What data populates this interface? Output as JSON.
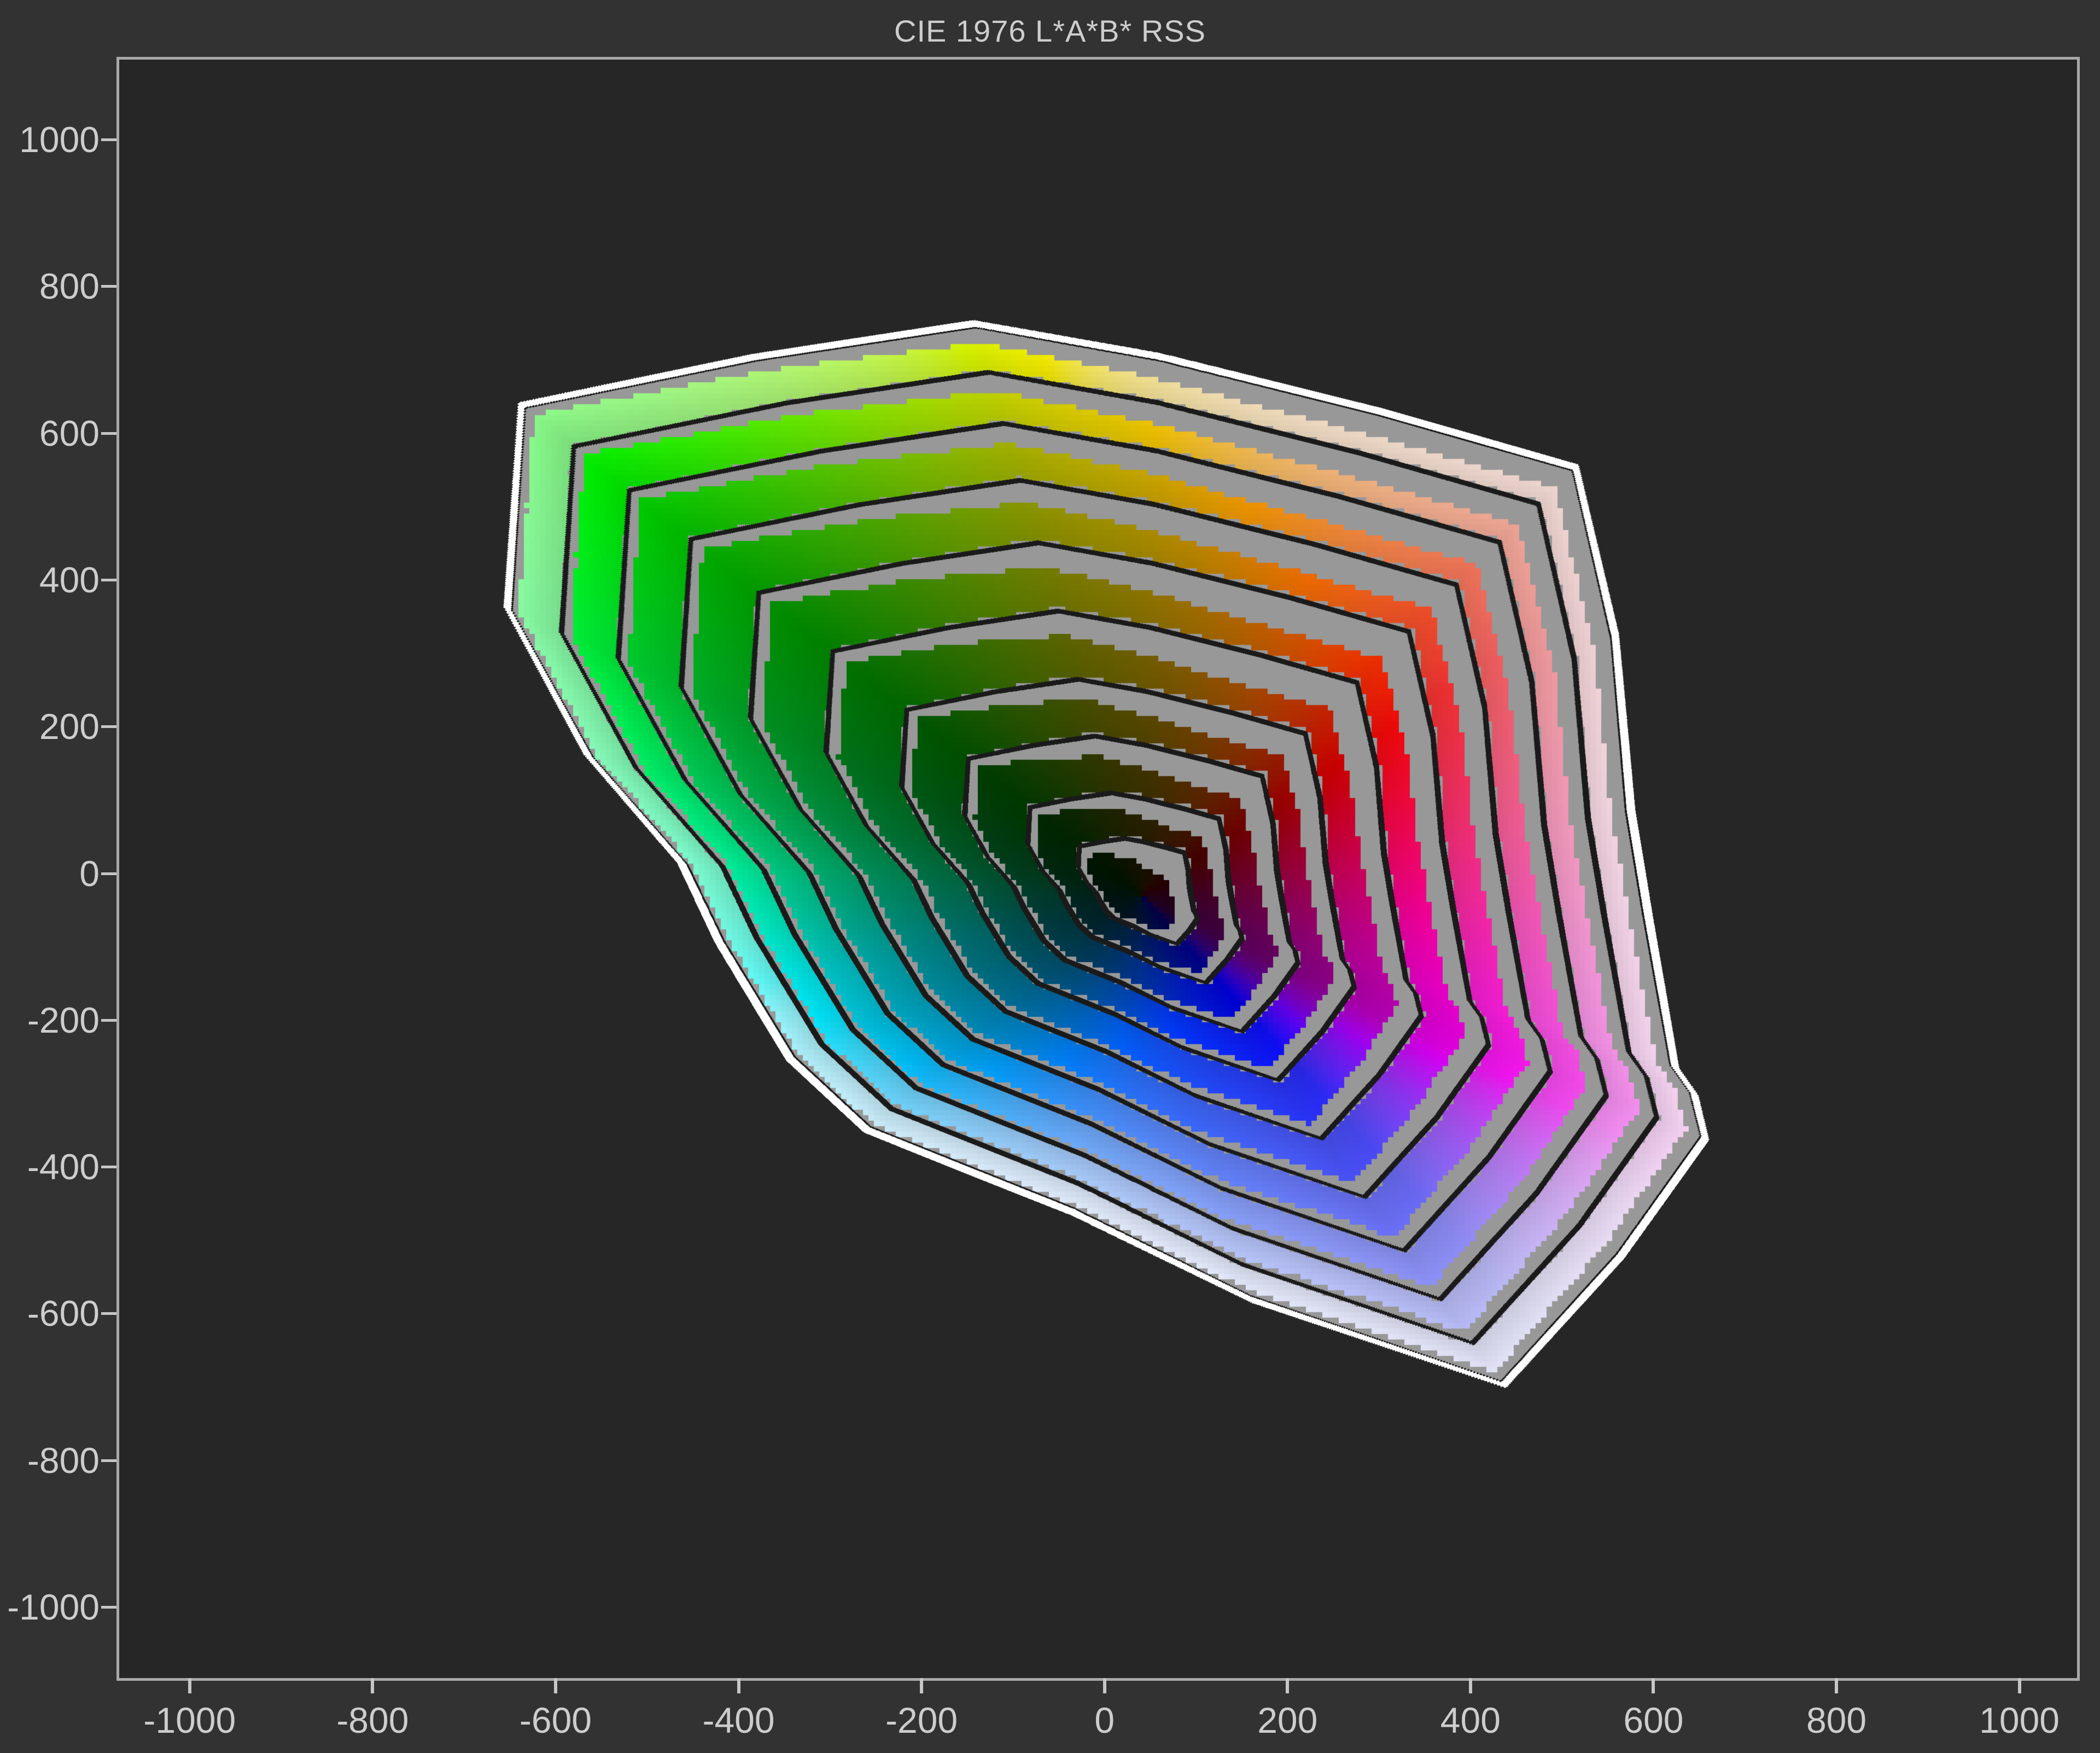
{
  "title": "CIE 1976 L*A*B* RSS",
  "colors": {
    "page_bg": "#323232",
    "plot_bg": "#262626",
    "axis_border": "#a8a8a8",
    "tick": "#c6c6c6",
    "tick_label": "#cdcdcd",
    "title": "#cdcdcd",
    "ring_gray": "#989898",
    "ring_outline": "#1a1a1a",
    "hull_outline": "#ffffff"
  },
  "axes": {
    "x": {
      "ticks": [
        -1000,
        -800,
        -600,
        -400,
        -200,
        0,
        200,
        400,
        600,
        800,
        1000
      ],
      "lim": [
        -1077,
        1063
      ]
    },
    "y": {
      "ticks": [
        1000,
        800,
        600,
        400,
        200,
        0,
        -200,
        -400,
        -600,
        -800,
        -1000
      ],
      "lim": [
        -1097,
        1109
      ]
    }
  },
  "chart_data": {
    "type": "area",
    "variant": "gamut-rings (CIELAB a*-b* RSS projection, nested lightness slices)",
    "title": "CIE 1976 L*A*B* RSS",
    "xlabel": "",
    "ylabel": "",
    "grid": false,
    "legend": false,
    "xlim": [
      -1077,
      1063
    ],
    "ylim": [
      -1097,
      1109
    ],
    "x_tick_labels": [
      "-1000",
      "-800",
      "-600",
      "-400",
      "-200",
      "0",
      "200",
      "400",
      "600",
      "800",
      "1000"
    ],
    "y_tick_labels": [
      "1000",
      "800",
      "600",
      "400",
      "200",
      "0",
      "-200",
      "-400",
      "-600",
      "-800",
      "-1000"
    ],
    "rings": {
      "count": 10,
      "L_star_slices": [
        10,
        20,
        30,
        40,
        50,
        60,
        70,
        80,
        90,
        100
      ],
      "display_L": [
        12,
        20,
        29,
        38,
        47,
        56,
        65,
        74,
        85,
        95
      ],
      "radial_fractions": [
        0.1,
        0.18,
        0.28,
        0.38,
        0.5,
        0.62,
        0.73,
        0.83,
        0.92,
        1.0
      ]
    },
    "center": [
      40,
      -30
    ],
    "outer_boundary": [
      [
        571,
        84
      ],
      [
        555,
        320
      ],
      [
        513,
        549
      ],
      [
        300,
        625
      ],
      [
        60,
        700
      ],
      [
        -140,
        745
      ],
      [
        -380,
        700
      ],
      [
        -633,
        636
      ],
      [
        -648,
        360
      ],
      [
        -560,
        160
      ],
      [
        -457,
        13
      ],
      [
        -417,
        -92
      ],
      [
        -340,
        -250
      ],
      [
        -257,
        -346
      ],
      [
        -35,
        -457
      ],
      [
        159,
        -577
      ],
      [
        433,
        -694
      ],
      [
        560,
        -520
      ],
      [
        652,
        -360
      ],
      [
        640,
        -300
      ],
      [
        619,
        -263
      ],
      [
        590,
        -60
      ]
    ],
    "hue_anchors_lab_to_css": [
      [
        40,
        0
      ],
      [
        100,
        60
      ],
      [
        136,
        120
      ],
      [
        196,
        180
      ],
      [
        306,
        240
      ],
      [
        328,
        300
      ],
      [
        400,
        360
      ]
    ],
    "gray_band": {
      "base": 0.18,
      "topright_amp": 0.42,
      "topright_angle_deg": 60,
      "right_amp": 0.22,
      "right_angle_deg": 335
    },
    "stroke_widths": {
      "ring_outline_units": 3.4,
      "hull_white_units": 9.5,
      "hull_inner_dark_units": 2.2
    },
    "pixel_block_size": 10
  }
}
